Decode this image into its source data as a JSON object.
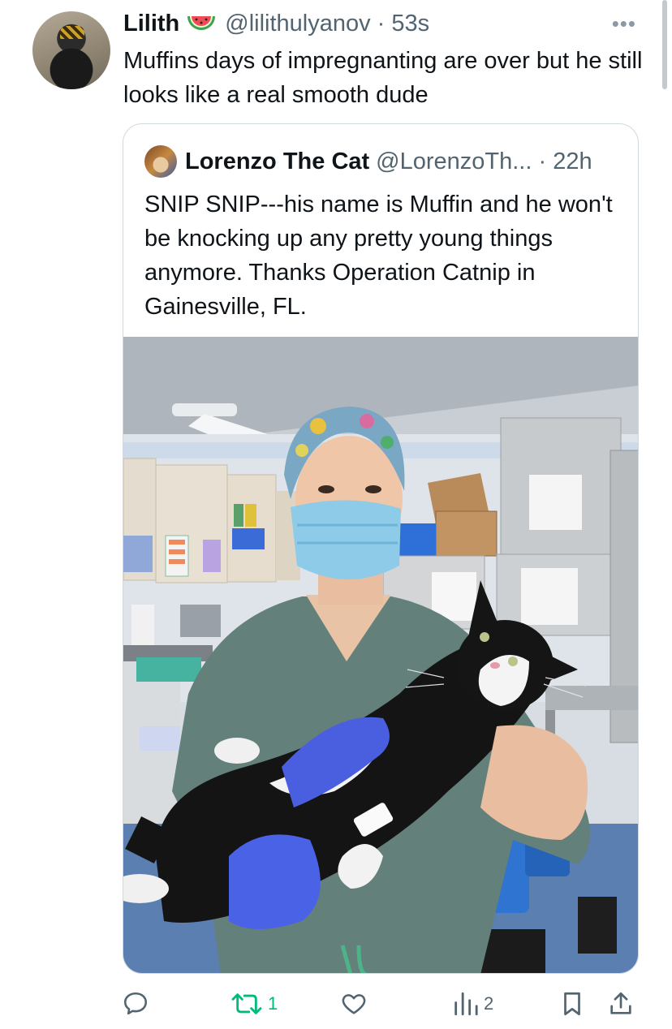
{
  "tweet": {
    "author_name": "Lilith",
    "author_emoji": "watermelon-icon",
    "handle_time": "@lilithulyanov · 53s",
    "text": "Muffins days of impregnanting are over but he still looks like a real smooth dude"
  },
  "quoted_tweet": {
    "author_name": "Lorenzo The Cat",
    "handle_time": "@LorenzoTh... · 22h",
    "text": "SNIP SNIP---his name is Muffin and he won't be knocking up any pretty young things anymore. Thanks Operation Catnip in Gainesville, FL."
  },
  "actions": {
    "reply_count": "",
    "retweet_count": "1",
    "like_count": "",
    "views_count": "2"
  },
  "colors": {
    "text": "#0f1419",
    "secondary": "#536471",
    "retweet_green": "#00ba7c",
    "border": "#cfd9de"
  }
}
